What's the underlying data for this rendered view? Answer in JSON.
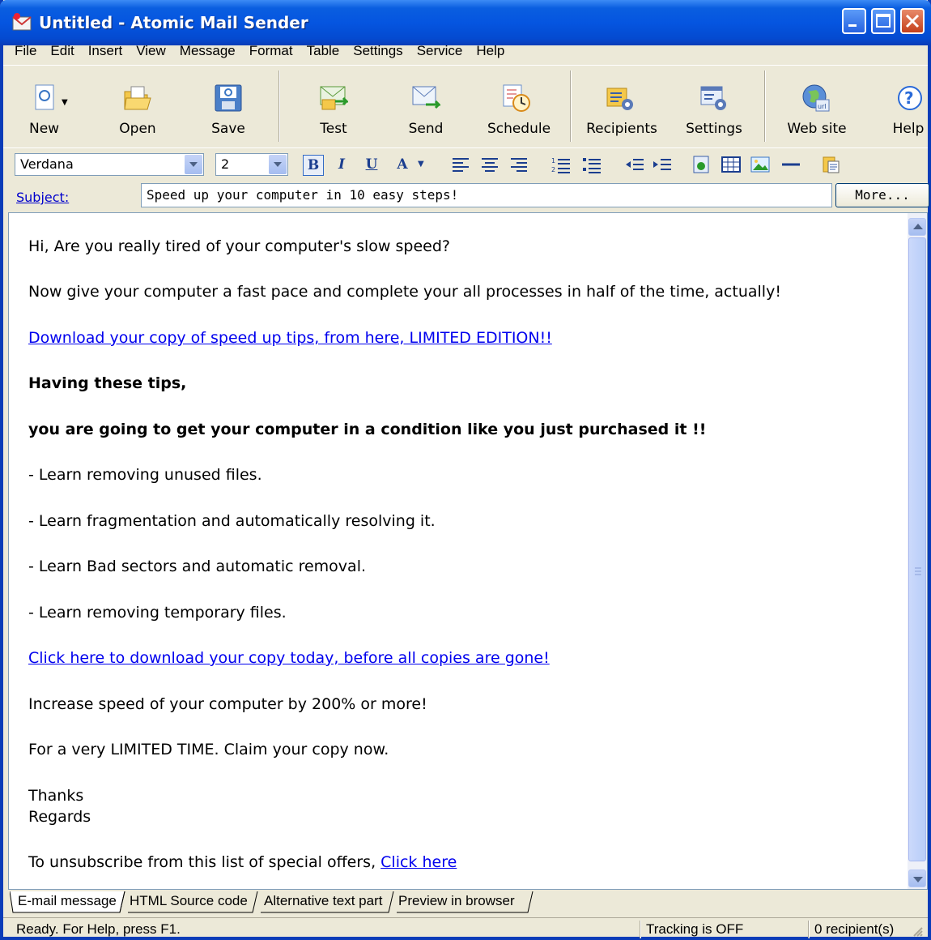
{
  "window": {
    "title": "Untitled - Atomic Mail Sender"
  },
  "menu": [
    "File",
    "Edit",
    "Insert",
    "View",
    "Message",
    "Format",
    "Table",
    "Settings",
    "Service",
    "Help"
  ],
  "toolbar": {
    "new": "New",
    "open": "Open",
    "save": "Save",
    "test": "Test",
    "send": "Send",
    "schedule": "Schedule",
    "recipients": "Recipients",
    "settings": "Settings",
    "website": "Web site",
    "help": "Help"
  },
  "format": {
    "font": "Verdana",
    "size": "2",
    "bold": "B",
    "italic": "I",
    "underline": "U",
    "fontcolor": "A"
  },
  "subject": {
    "label": "Subject:",
    "value": "Speed up your computer in 10 easy steps!",
    "more": "More..."
  },
  "body": {
    "l1": "Hi, Are you really tired of your computer's slow speed?",
    "l2": "Now give your computer a fast pace and complete your all processes in half of the time, actually!",
    "link1": "Download your copy of speed up tips, from here, LIMITED EDITION!! ",
    "b1": "Having these tips,",
    "b2": "you are going to get your computer in a condition like you just purchased it !!",
    "li1": "- Learn removing unused files.",
    "li2": "- Learn fragmentation and automatically resolving it.",
    "li3": "- Learn Bad sectors and automatic removal.",
    "li4": "- Learn removing temporary files.",
    "link2": "Click here to download your copy today, before all copies are gone!",
    "l3": "Increase speed of your computer by 200% or more!",
    "l4": "For a very LIMITED TIME. Claim your copy now.",
    "l5": "Thanks",
    "l6": "Regards",
    "unsub": "To unsubscribe from this list of special offers, ",
    "unsub_link": "Click here"
  },
  "tabs": [
    "E-mail message",
    "HTML Source code",
    "Alternative text part",
    "Preview in browser"
  ],
  "status": {
    "ready": "Ready. For Help, press F1.",
    "tracking": "Tracking is OFF",
    "recipients": "0 recipient(s)"
  }
}
